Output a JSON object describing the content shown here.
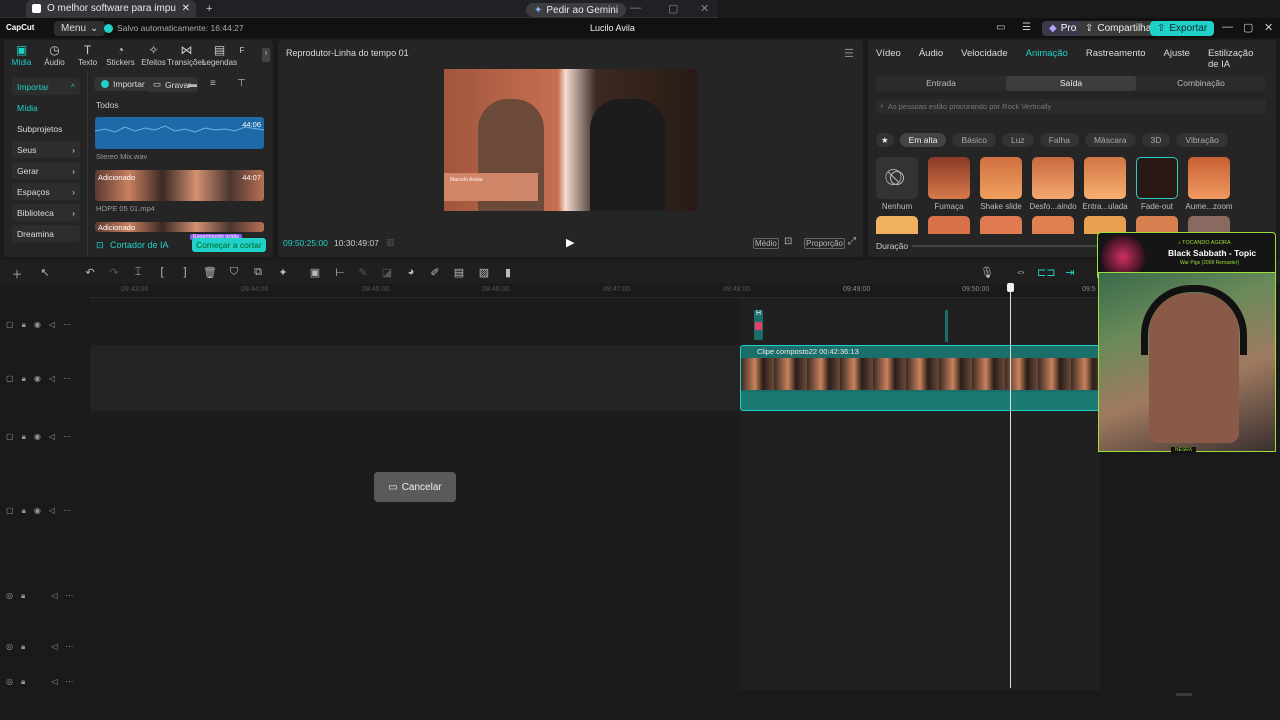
{
  "browser": {
    "tab_title": "O melhor software para impul",
    "close": "✕",
    "new_tab": "+",
    "gemini": "Pedir ao Gemini",
    "win_min": "—",
    "win_max": "▢",
    "win_close": "✕"
  },
  "titlebar": {
    "logo": "CapCut",
    "menu": "Menu",
    "autosave": "Salvo automaticamente: 16:44:27",
    "project": "Lucilo Avila",
    "pro": "Pro",
    "share": "Compartilhar",
    "export": "Exportar"
  },
  "media_tabs": [
    {
      "label": "Mídia",
      "icon": "▣"
    },
    {
      "label": "Áudio",
      "icon": "◷"
    },
    {
      "label": "Texto",
      "icon": "T"
    },
    {
      "label": "Stickers",
      "icon": "◔"
    },
    {
      "label": "Efeitos",
      "icon": "✧"
    },
    {
      "label": "Transições",
      "icon": "⋈"
    },
    {
      "label": "Legendas",
      "icon": "▤"
    },
    {
      "label": "F",
      "icon": ""
    }
  ],
  "sidebar": [
    {
      "label": "Importar",
      "chev": "^"
    },
    {
      "label": "Mídia",
      "chev": ""
    },
    {
      "label": "Subprojetos",
      "chev": ""
    },
    {
      "label": "Seus",
      "chev": "›"
    },
    {
      "label": "Gerar",
      "chev": "›"
    },
    {
      "label": "Espaços",
      "chev": "›"
    },
    {
      "label": "Biblioteca",
      "chev": "›"
    },
    {
      "label": "Dreamina",
      "chev": ""
    }
  ],
  "media_toolbar": {
    "import": "Importar",
    "record": "Gravar",
    "sort": "≡",
    "filter": "⊤"
  },
  "media_list": {
    "heading": "Todos",
    "items": [
      {
        "name": "Stereo Mix.wav",
        "duration": "44:06",
        "badge": ""
      },
      {
        "name": "HOPE 05 01.mp4",
        "duration": "44:07",
        "badge": "Adicionado"
      },
      {
        "name": "",
        "duration": "",
        "badge": "Adicionado"
      }
    ]
  },
  "ai_cutter": {
    "label": "Cortador de IA",
    "start": "Começar a cortar",
    "promo": "Experimente grátis"
  },
  "player": {
    "title": "Reprodutor-Linha do tempo 01",
    "current": "09:50:25:00",
    "total": "10:30:49:07",
    "quality": "Médio",
    "ratio": "Proporção",
    "lower_third": "Marcelo Avelar"
  },
  "right_tabs": [
    "Vídeo",
    "Áudio",
    "Velocidade",
    "Animação",
    "Rastreamento",
    "Ajuste",
    "Estilização de IA"
  ],
  "anim_sub": [
    "Entrada",
    "Saída",
    "Combinação"
  ],
  "search_placeholder": "As pessoas estão procurando por Rock Vertically",
  "categories": [
    "Em alta",
    "Básico",
    "Luz",
    "Falha",
    "Máscara",
    "3D",
    "Vibração"
  ],
  "effects": [
    {
      "label": "Nenhum",
      "color": "#333333"
    },
    {
      "label": "Fumaça",
      "color": "#a0503a"
    },
    {
      "label": "Shake slide",
      "color": "#d07545"
    },
    {
      "label": "Desfo...aindo",
      "color": "#d88050"
    },
    {
      "label": "Entra...ulada",
      "color": "#e08855"
    },
    {
      "label": "Fade-out",
      "color": "#3a2420"
    },
    {
      "label": "Aume...zoom",
      "color": "#d07040"
    }
  ],
  "duration_label": "Duração",
  "timeline": {
    "ruler": [
      "09:43:00",
      "09:44:00",
      "09:45:00",
      "09:46:00",
      "09:47:00",
      "09:48:00",
      "09:49:00",
      "09:50:00",
      "09:5"
    ],
    "clip_label": "Clipe composto22  00:42:36:13",
    "cancel": "Cancelar",
    "marker": "H"
  },
  "overlay": {
    "now_playing": "♪ TOCANDO AGORA",
    "track": "Black Sabbath - Topic",
    "subtitle": "War Pigs (2009 Remaster)",
    "cam_tag": "NESRX"
  },
  "colors": {
    "accent": "#1fd1c9",
    "panel": "#252525",
    "bg": "#1a1a1a",
    "overlay_green": "#9adf3a"
  }
}
